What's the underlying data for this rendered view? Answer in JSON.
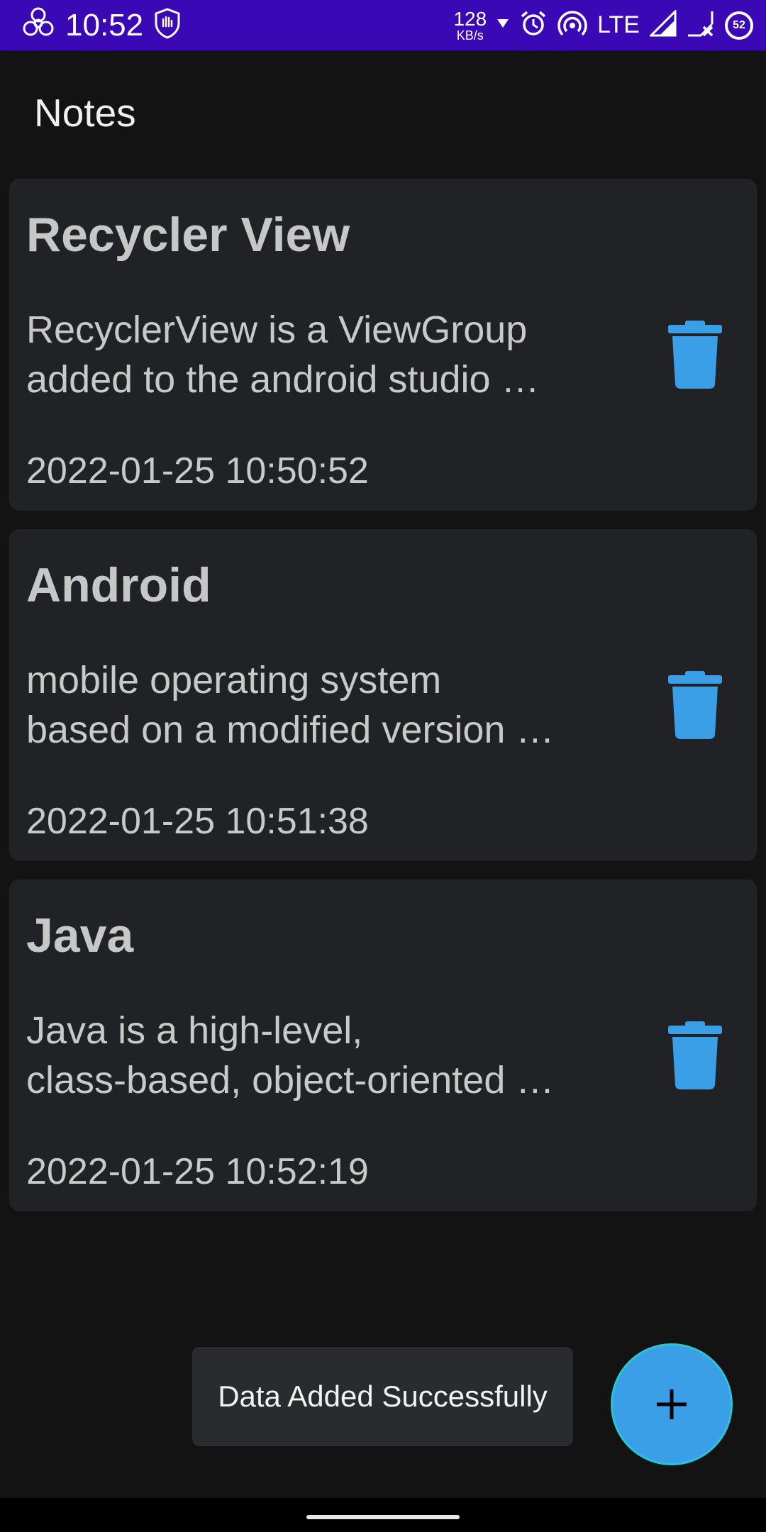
{
  "status_bar": {
    "time": "10:52",
    "speed_value": "128",
    "speed_unit": "KB/s",
    "network": "LTE",
    "battery": "52",
    "icons": [
      "biohazard-icon",
      "shield-hand-icon",
      "data-arrow-icon",
      "alarm-icon",
      "hotspot-icon",
      "signal-icon",
      "signal-x-icon",
      "battery-icon"
    ]
  },
  "app_bar": {
    "title": "Notes"
  },
  "notes": [
    {
      "title": "Recycler View",
      "desc_line1": "RecyclerView is a ViewGroup",
      "desc_line2": "added to the android studio …",
      "date": "2022-01-25 10:50:52"
    },
    {
      "title": "Android",
      "desc_line1": "mobile operating system",
      "desc_line2": "based on a modified version …",
      "date": "2022-01-25 10:51:38"
    },
    {
      "title": "Java",
      "desc_line1": "Java is a high-level,",
      "desc_line2": "class-based, object-oriented …",
      "date": "2022-01-25 10:52:19"
    }
  ],
  "toast": {
    "message": "Data Added Successfully"
  },
  "fab": {
    "icon": "plus-icon"
  },
  "colors": {
    "status_bar": "#3a08b4",
    "background": "#131313",
    "card": "#212225",
    "accent": "#3b9fe7"
  }
}
